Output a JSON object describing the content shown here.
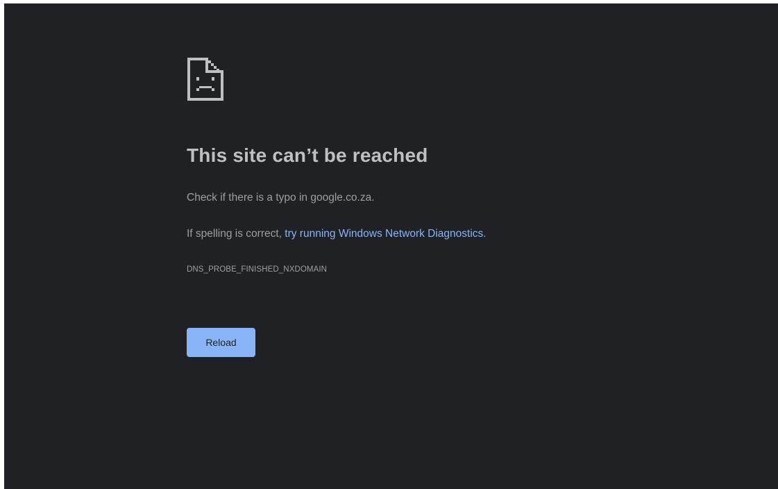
{
  "page": {
    "background_color": "#202124"
  },
  "error": {
    "icon": "sad-document-icon",
    "title": "This site can’t be reached",
    "typo_hint": "Check if there is a typo in google.co.za.",
    "diagnostics_prefix": "If spelling is correct, ",
    "diagnostics_link": "try running Windows Network Diagnostics",
    "diagnostics_suffix": ".",
    "code": "DNS_PROBE_FINISHED_NXDOMAIN"
  },
  "actions": {
    "reload_label": "Reload",
    "reload_color": "#8ab4f8"
  },
  "colors": {
    "title": "#bdc1c6",
    "body_text": "#9aa0a6",
    "link": "#8ab4f8"
  }
}
